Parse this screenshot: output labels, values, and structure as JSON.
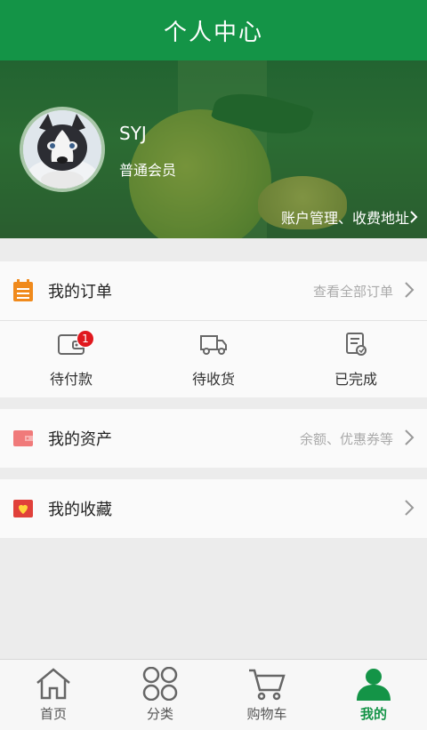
{
  "header": {
    "title": "个人中心"
  },
  "profile": {
    "username": "SYJ",
    "member_level": "普通会员",
    "account_link": "账户管理、收费地址",
    "account_chevron": "›"
  },
  "orders": {
    "label": "我的订单",
    "hint": "查看全部订单",
    "items": [
      {
        "label": "待付款",
        "icon": "wallet-icon",
        "badge": "1"
      },
      {
        "label": "待收货",
        "icon": "truck-icon"
      },
      {
        "label": "已完成",
        "icon": "receipt-icon"
      }
    ]
  },
  "assets": {
    "label": "我的资产",
    "hint": "余额、优惠券等"
  },
  "favorites": {
    "label": "我的收藏"
  },
  "bottom_nav": {
    "tabs": [
      {
        "label": "首页",
        "icon": "home-icon"
      },
      {
        "label": "分类",
        "icon": "category-icon"
      },
      {
        "label": "购物车",
        "icon": "cart-icon"
      },
      {
        "label": "我的",
        "icon": "user-icon",
        "active": true
      }
    ]
  },
  "colors": {
    "brand": "#149447",
    "badge": "#e0181e",
    "orders_icon": "#f08a1c",
    "assets_icon": "#f07a7a",
    "favorites_icon": "#e0403a"
  }
}
